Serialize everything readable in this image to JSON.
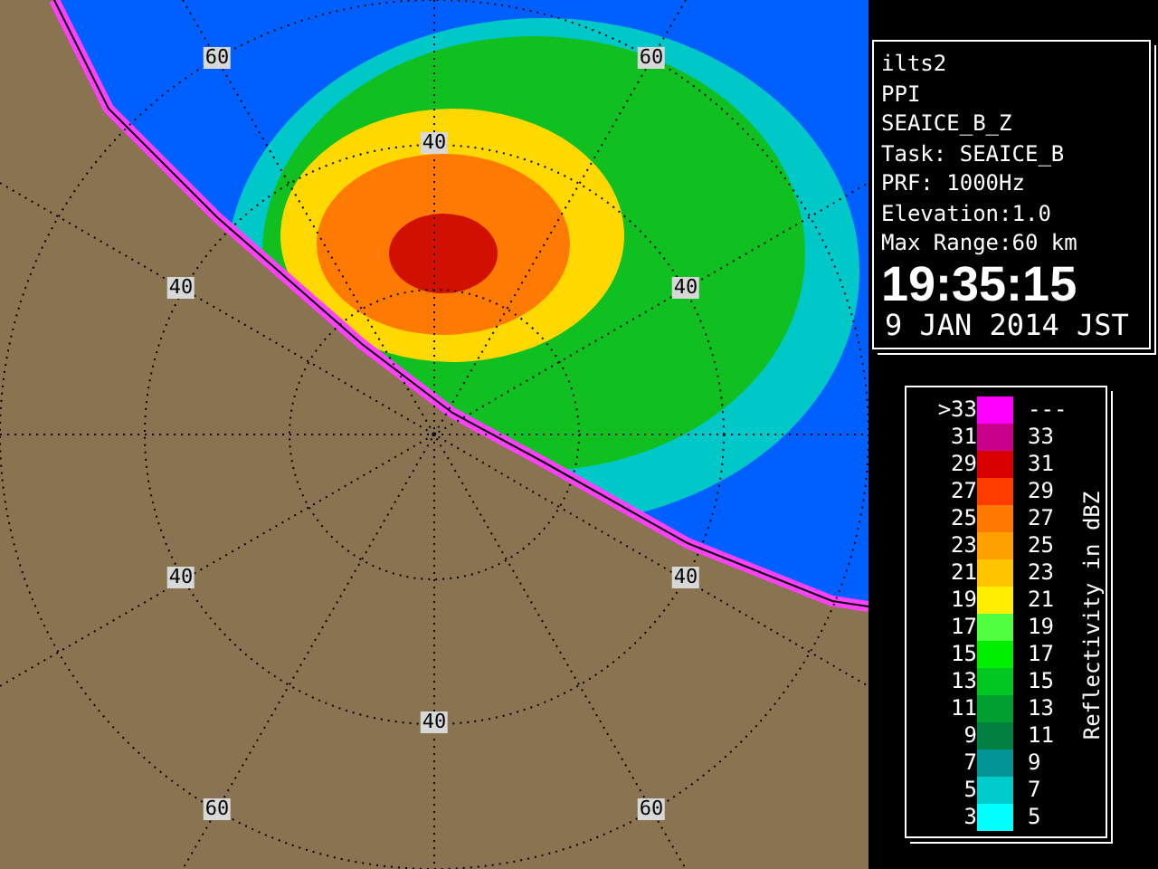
{
  "radar_map": {
    "ring_labels": [
      "60",
      "60",
      "40",
      "40",
      "40",
      "40",
      "40",
      "40",
      "60",
      "60"
    ]
  },
  "info_panel": {
    "lines": [
      "ilts2",
      "PPI",
      "SEAICE_B_Z",
      "Task: SEAICE_B",
      "PRF: 1000Hz",
      "Elevation:1.0",
      "Max Range:60 km"
    ],
    "time": "19:35:15",
    "date": "9 JAN 2014 JST"
  },
  "legend": {
    "title": "Reflectivity in dBZ",
    "rows": [
      {
        "low": ">33",
        "high": "---",
        "color": "#ff00ff"
      },
      {
        "low": "31",
        "high": "33",
        "color": "#c8008c"
      },
      {
        "low": "29",
        "high": "31",
        "color": "#d80000"
      },
      {
        "low": "27",
        "high": "29",
        "color": "#ff3c00"
      },
      {
        "low": "25",
        "high": "27",
        "color": "#ff7800"
      },
      {
        "low": "23",
        "high": "25",
        "color": "#ffa000"
      },
      {
        "low": "21",
        "high": "23",
        "color": "#ffc400"
      },
      {
        "low": "19",
        "high": "21",
        "color": "#ffee00"
      },
      {
        "low": "17",
        "high": "19",
        "color": "#50ff40"
      },
      {
        "low": "15",
        "high": "17",
        "color": "#00f000"
      },
      {
        "low": "13",
        "high": "15",
        "color": "#00c820"
      },
      {
        "low": "11",
        "high": "13",
        "color": "#00a030"
      },
      {
        "low": "9",
        "high": "11",
        "color": "#008040"
      },
      {
        "low": "7",
        "high": "9",
        "color": "#009494"
      },
      {
        "low": "5",
        "high": "7",
        "color": "#00cccc"
      },
      {
        "low": "3",
        "high": "5",
        "color": "#00ffff"
      }
    ]
  }
}
